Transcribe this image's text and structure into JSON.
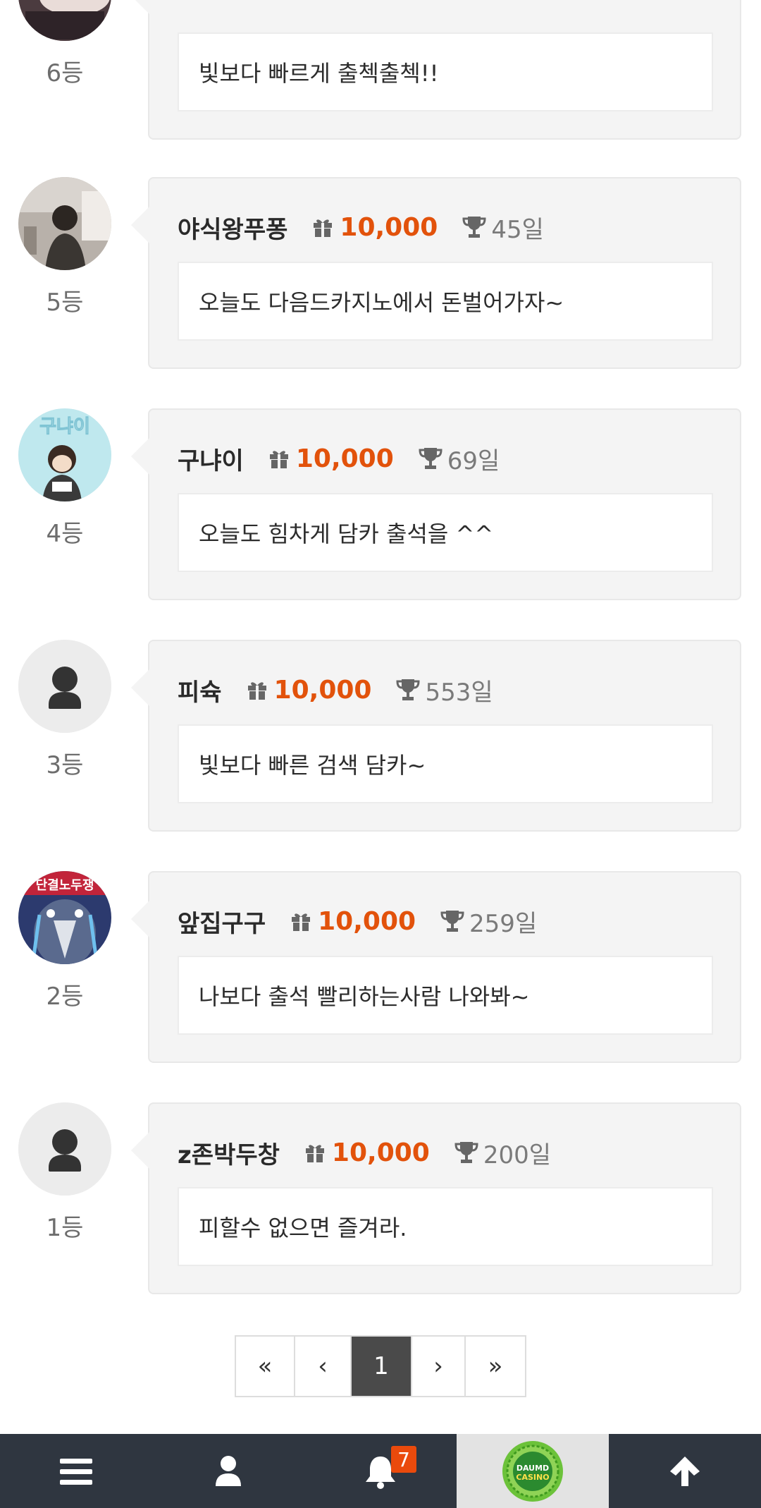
{
  "entries": [
    {
      "rank": "6등",
      "nickname": "",
      "points": "",
      "days": "",
      "message": "빛보다 빠르게 출첵출첵!!",
      "avatar": "avatar-photo-icon"
    },
    {
      "rank": "5등",
      "nickname": "야식왕푸퐁",
      "points": "10,000",
      "days": "45일",
      "message": "오늘도 다음드카지노에서 돈벌어가자~",
      "avatar": "avatar-photo-icon"
    },
    {
      "rank": "4등",
      "nickname": "구냐이",
      "points": "10,000",
      "days": "69일",
      "message": "오늘도 힘차게 담카 출석을 ^^",
      "avatar": "avatar-cartoon-icon",
      "avatar_text": "구냐이"
    },
    {
      "rank": "3등",
      "nickname": "피슉",
      "points": "10,000",
      "days": "553일",
      "message": "빛보다 빠른 검색 담카~",
      "avatar": "default-user-icon"
    },
    {
      "rank": "2등",
      "nickname": "앞집구구",
      "points": "10,000",
      "days": "259일",
      "message": "나보다 출석 빨리하는사람 나와봐~",
      "avatar": "avatar-penguin-icon",
      "avatar_text": "단결노두쟁"
    },
    {
      "rank": "1등",
      "nickname": "z존박두창",
      "points": "10,000",
      "days": "200일",
      "message": "피할수 없으면 즐겨라.",
      "avatar": "default-user-icon"
    }
  ],
  "pagination": {
    "first": "«",
    "prev": "‹",
    "current": "1",
    "next": "›",
    "last": "»"
  },
  "bottom_bar": {
    "menu_icon": "menu-icon",
    "user_icon": "user-icon",
    "notification_icon": "bell-icon",
    "notification_count": "7",
    "logo_text_1": "DAUMD",
    "logo_text_2": "CASINO",
    "top_icon": "arrow-up-icon"
  },
  "colors": {
    "points": "#e2520b",
    "badge": "#ea4a0c",
    "bar_bg": "#2f3640",
    "active_page": "#4a4a4a"
  }
}
